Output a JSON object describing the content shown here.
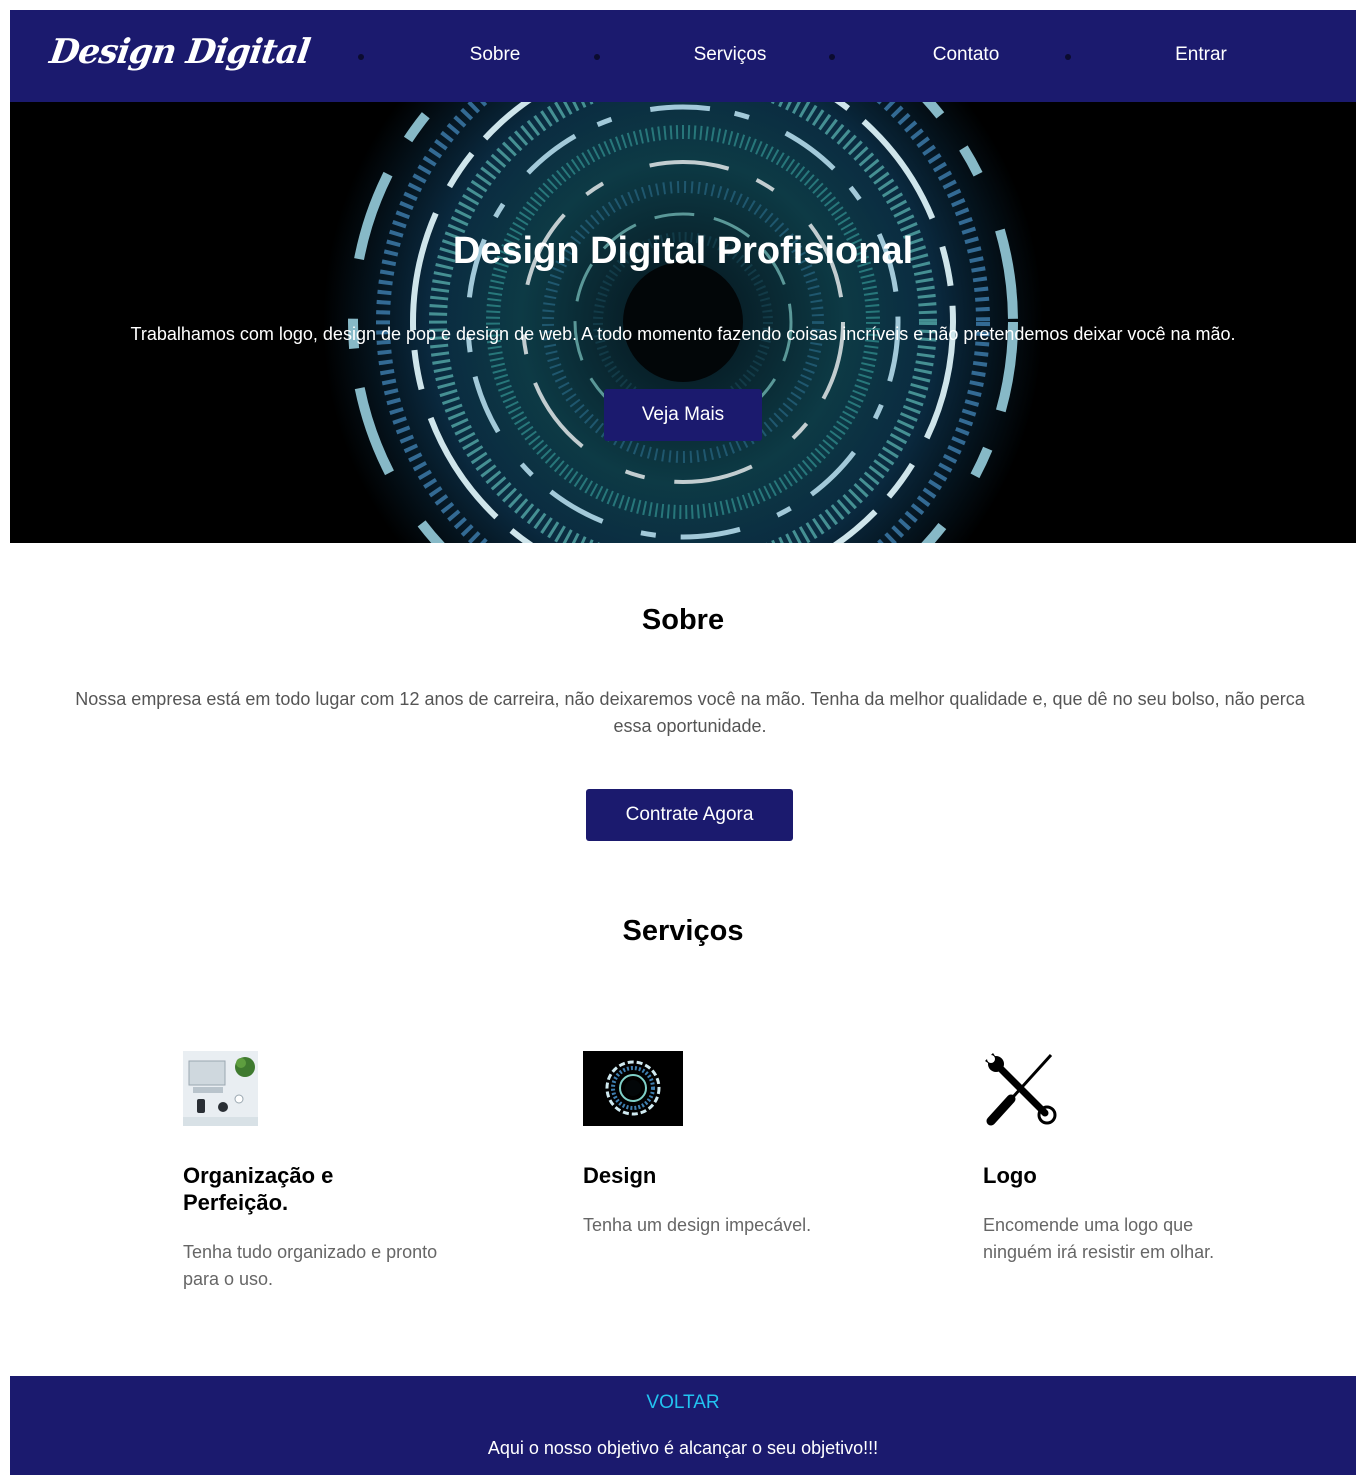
{
  "nav": {
    "logo": "Design Digital",
    "items": [
      {
        "label": "Sobre"
      },
      {
        "label": "Serviços"
      },
      {
        "label": "Contato"
      },
      {
        "label": "Entrar"
      }
    ]
  },
  "hero": {
    "title": "Design Digital Profisional",
    "text": "Trabalhamos com logo, design de pop e design de web. A todo momento fazendo coisas incríveis e não pretendemos deixar você na mão.",
    "button": "Veja Mais"
  },
  "sobre": {
    "title": "Sobre",
    "text": "Nossa empresa está em todo lugar com 12 anos de carreira, não deixaremos você na mão. Tenha da melhor qualidade e, que dê no seu bolso, não perca essa oportunidade.",
    "button": "Contrate Agora"
  },
  "servicos": {
    "title": "Serviços",
    "items": [
      {
        "icon": "workspace-photo-icon",
        "title": "Organização e Perfeição.",
        "text": "Tenha tudo organizado e pronto para o uso."
      },
      {
        "icon": "digital-circle-photo-icon",
        "title": "Design",
        "text": "Tenha um design impecável."
      },
      {
        "icon": "wrench-screwdriver-icon",
        "title": "Logo",
        "text": "Encomende uma logo que ninguém irá resistir em olhar."
      }
    ]
  },
  "footer": {
    "link": "VOLTAR",
    "text": "Aqui o nosso objetivo é alcançar o seu objetivo!!!"
  },
  "colors": {
    "primary": "#1b1a6e",
    "footer_link": "#22c3f0"
  }
}
